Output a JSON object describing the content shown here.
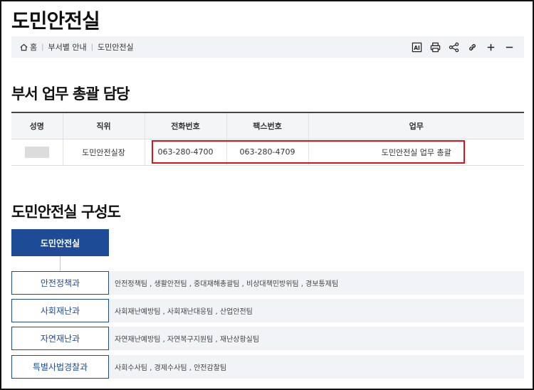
{
  "page": {
    "title": "도민안전실"
  },
  "breadcrumb": {
    "home": "홈",
    "level1": "부서별 안내",
    "level2": "도민안전실"
  },
  "toolbar": {
    "icons": [
      "ai-icon",
      "print-icon",
      "share-icon",
      "link-icon",
      "zoom-in-icon",
      "zoom-out-icon"
    ]
  },
  "staff_section": {
    "heading": "부서 업무 총괄 담당",
    "columns": [
      "성명",
      "직위",
      "전화번호",
      "팩스번호",
      "업무"
    ],
    "row": {
      "name": "",
      "position": "도민안전실장",
      "phone": "063-280-4700",
      "fax": "063-280-4709",
      "duty": "도민안전실 업무 총괄"
    }
  },
  "org_section": {
    "heading": "도민안전실 구성도",
    "root": "도민안전실",
    "departments": [
      {
        "name": "안전정책과",
        "teams": "안전정책팀 , 생활안전팀 , 중대재해총괄팀 , 비상대책민방위팀 , 경보통제팀"
      },
      {
        "name": "사회재난과",
        "teams": "사회재난예방팀 , 사회재난대응팀 , 산업안전팀"
      },
      {
        "name": "자연재난과",
        "teams": "자연재난예방팀 , 자연복구지원팀 , 재난상황실팀"
      },
      {
        "name": "특별사법경찰과",
        "teams": "사회수사팀 , 경제수사팀 , 안전감찰팀"
      }
    ]
  },
  "colors": {
    "primary": "#1e4b96",
    "highlight": "#e0111b"
  }
}
